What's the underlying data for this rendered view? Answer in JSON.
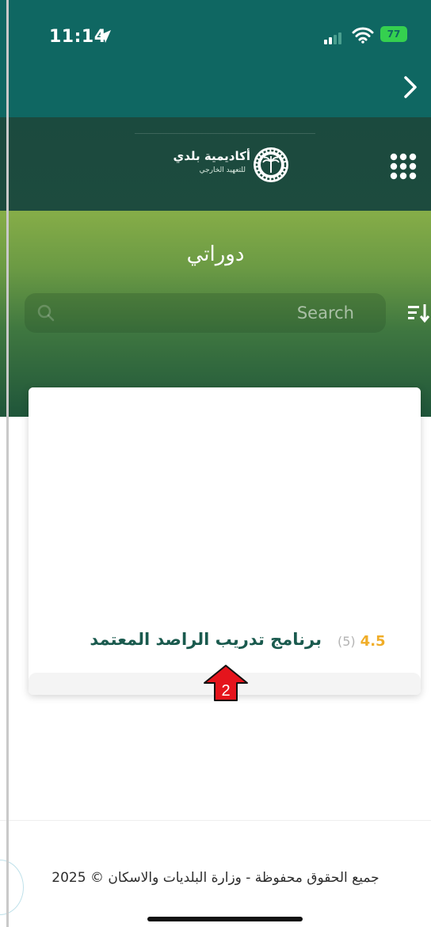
{
  "status_bar": {
    "time": "11:14",
    "battery": "77"
  },
  "header": {
    "logo_title": "أكاديمية بلدي",
    "logo_subtitle": "للتعهيد الخارجي"
  },
  "hero": {
    "title": "دوراتي"
  },
  "search": {
    "placeholder": "Search"
  },
  "course": {
    "title": "برنامج تدريب الراصد المعتمد",
    "rating": "4.5",
    "rating_count": "(5)"
  },
  "annotation": {
    "number": "2"
  },
  "footer": {
    "copyright": "جميع الحقوق محفوظة - وزارة البلديات والاسكان © 2025"
  },
  "colors": {
    "status_bar": "#0f6762",
    "header": "#1b4a3e",
    "hero_top": "#86ad48",
    "hero_bottom": "#1f553a",
    "course_title": "#1a5a4e",
    "rating": "#f0ad28",
    "annotation_red": "#e5141c"
  }
}
